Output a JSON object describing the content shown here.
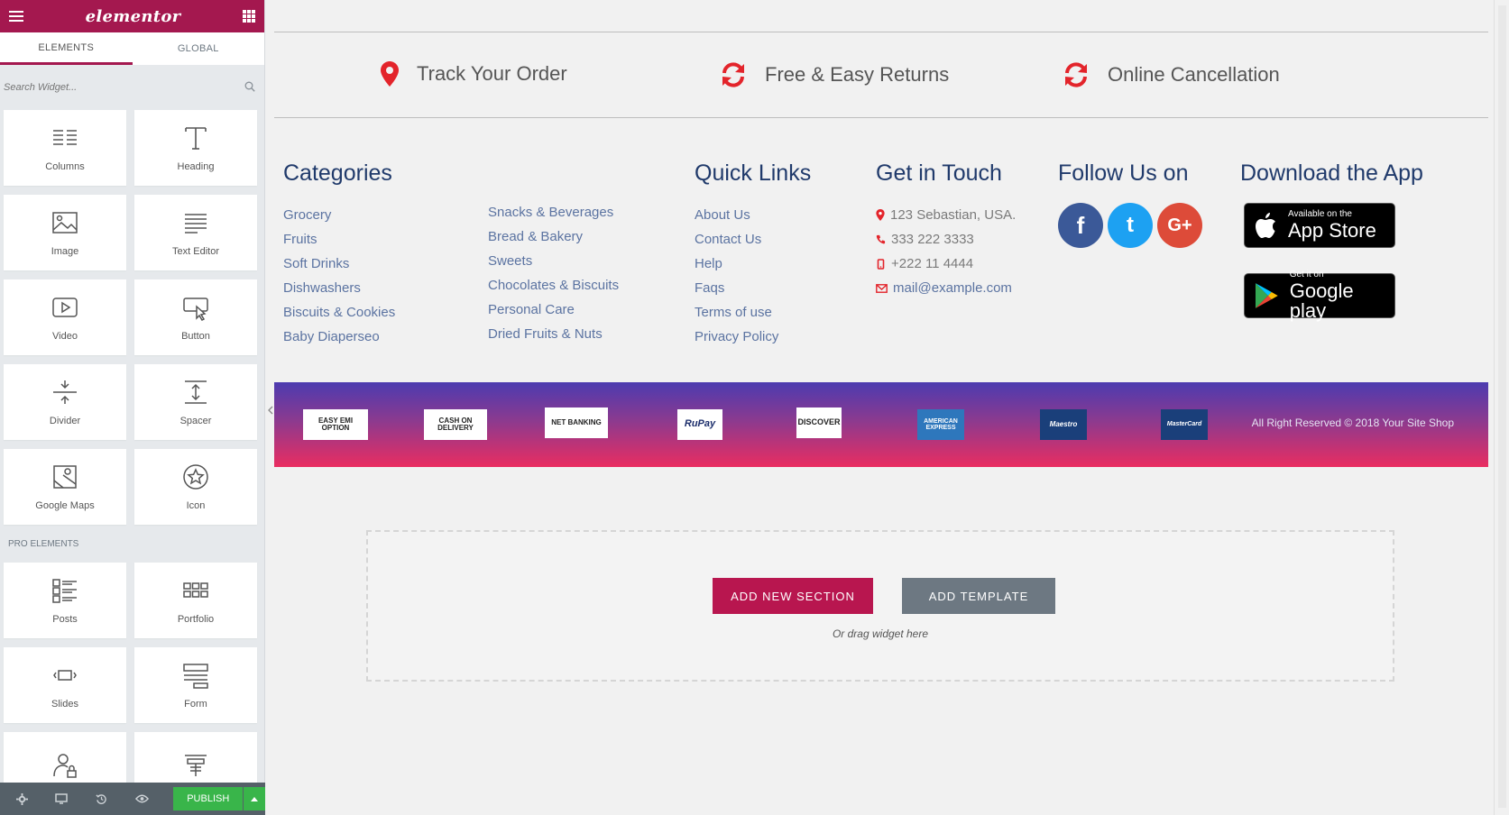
{
  "sidebar": {
    "logo": "elementor",
    "tabs": [
      "ELEMENTS",
      "GLOBAL"
    ],
    "search_placeholder": "Search Widget...",
    "widgets": [
      "Columns",
      "Heading",
      "Image",
      "Text Editor",
      "Video",
      "Button",
      "Divider",
      "Spacer",
      "Google Maps",
      "Icon"
    ],
    "pro_label": "PRO ELEMENTS",
    "pro_widgets": [
      "Posts",
      "Portfolio",
      "Slides",
      "Form"
    ],
    "footer": {
      "publish": "PUBLISH"
    }
  },
  "features": [
    "Track Your Order",
    "Free & Easy Returns",
    "Online Cancellation"
  ],
  "categories": {
    "title": "Categories",
    "col1": [
      "Grocery",
      "Fruits",
      "Soft Drinks",
      "Dishwashers",
      "Biscuits & Cookies",
      "Baby Diaperseo"
    ],
    "col2": [
      "Snacks & Beverages",
      "Bread & Bakery",
      "Sweets",
      "Chocolates & Biscuits",
      "Personal Care",
      "Dried Fruits & Nuts"
    ]
  },
  "quick_links": {
    "title": "Quick Links",
    "items": [
      "About Us",
      "Contact Us",
      "Help",
      "Faqs",
      "Terms of use",
      "Privacy Policy"
    ]
  },
  "contact": {
    "title": "Get in Touch",
    "address": "123 Sebastian, USA.",
    "phone": "333 222 3333",
    "mobile": "+222 11 4444",
    "email": "mail@example.com"
  },
  "follow": {
    "title": "Follow Us on",
    "networks": [
      "f",
      "t",
      "G+"
    ]
  },
  "app": {
    "title": "Download the App",
    "appstore_small": "Available on the",
    "appstore_big": "App Store",
    "gplay_small": "Get it on",
    "gplay_big": "Google play"
  },
  "payments": [
    "EASY EMI OPTION",
    "CASH ON DELIVERY",
    "NET BANKING",
    "RuPay",
    "DISCOVER",
    "AMERICAN EXPRESS",
    "Maestro",
    "MasterCard"
  ],
  "copyright": "All Right Reserved © 2018 Your Site Shop",
  "dropzone": {
    "add_section": "ADD NEW SECTION",
    "add_template": "ADD TEMPLATE",
    "hint": "Or drag widget here"
  },
  "colors": {
    "brand": "#a4184f",
    "publish": "#39b54a",
    "heading": "#203a6b",
    "link": "#5b73a1",
    "icon_red": "#e3242b"
  }
}
